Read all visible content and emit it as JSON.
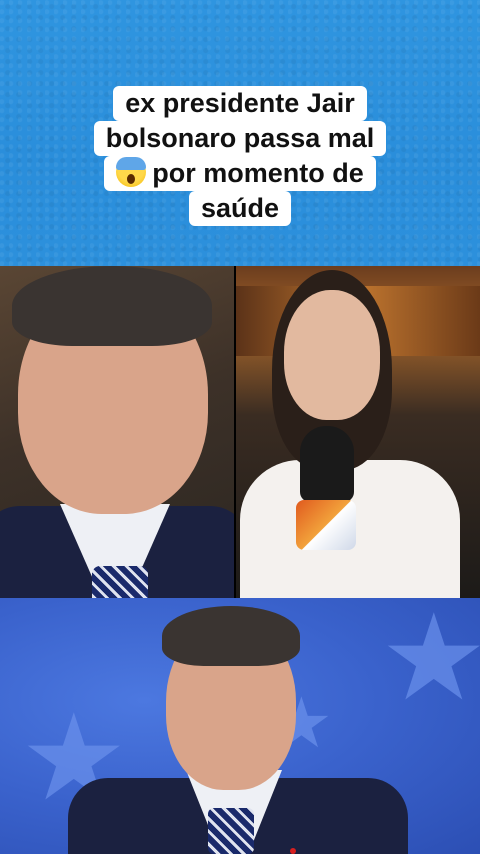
{
  "caption": {
    "line1": "ex presidente Jair",
    "line2": "bolsonaro passa mal",
    "line3_emoji": "screaming-face-emoji",
    "line3_text": "por momento de",
    "line4": "saúde"
  },
  "colors": {
    "top_background": "#2c90dc",
    "caption_background": "#ffffff",
    "bottom_background": "#3a62cc"
  }
}
